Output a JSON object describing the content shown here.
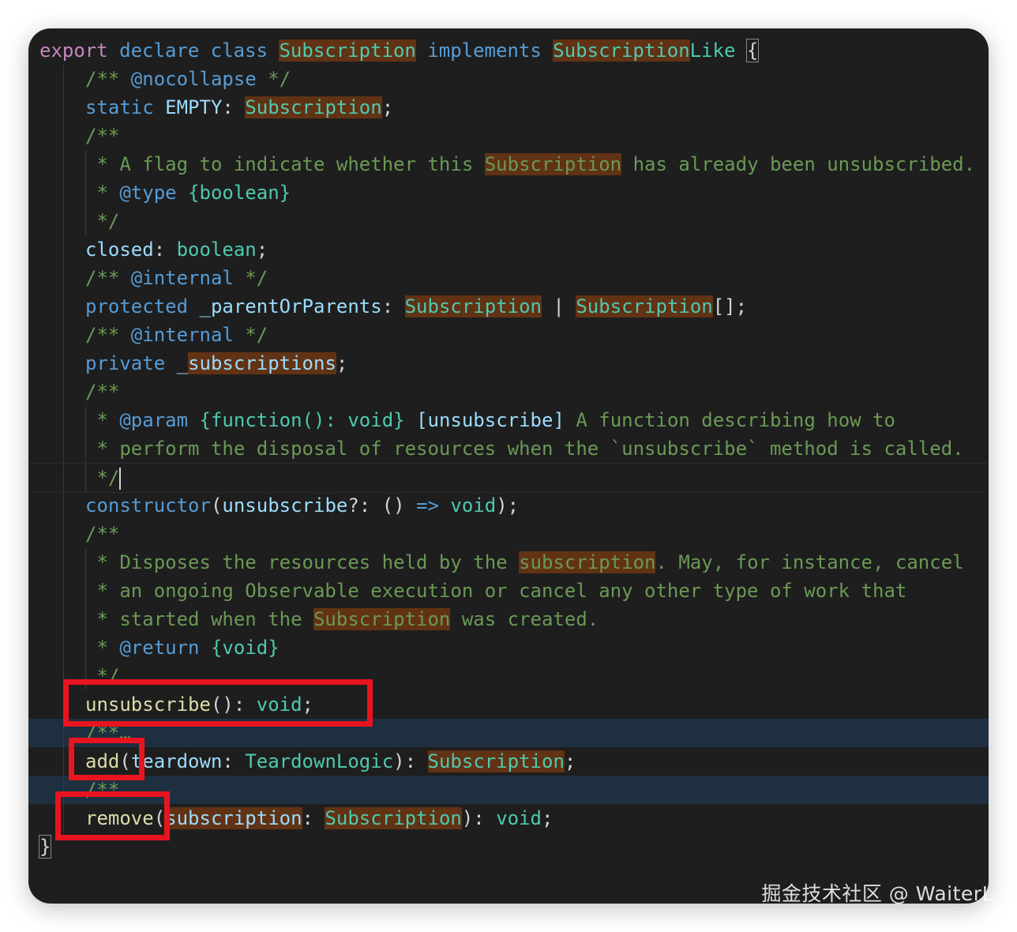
{
  "editor": {
    "lines": [
      {
        "id": "l1",
        "tokens": [
          [
            "export",
            "kw"
          ],
          [
            " ",
            "pn"
          ],
          [
            "declare",
            "kb"
          ],
          [
            " ",
            "pn"
          ],
          [
            "class",
            "kb"
          ],
          [
            " ",
            "pn"
          ],
          [
            "Subscription",
            "ty mark"
          ],
          [
            " ",
            "pn"
          ],
          [
            "implements",
            "kb"
          ],
          [
            " ",
            "pn"
          ],
          [
            "Subscription",
            "ty mark"
          ],
          [
            "Like",
            "ty"
          ],
          [
            " ",
            "pn"
          ],
          [
            "{",
            "pn brace-box"
          ]
        ]
      },
      {
        "id": "l2",
        "tokens": [
          [
            "/** ",
            "cm"
          ],
          [
            "@nocollapse",
            "cm-tag"
          ],
          [
            " */",
            "cm"
          ]
        ]
      },
      {
        "id": "l3",
        "tokens": [
          [
            "static",
            "kb"
          ],
          [
            " ",
            "pn"
          ],
          [
            "EMPTY",
            "id"
          ],
          [
            ": ",
            "pn"
          ],
          [
            "Subscription",
            "ty mark"
          ],
          [
            ";",
            "pn"
          ]
        ]
      },
      {
        "id": "l4",
        "tokens": [
          [
            "/**",
            "cm"
          ]
        ]
      },
      {
        "id": "l5",
        "tokens": [
          [
            " * A flag to indicate whether this ",
            "cm"
          ],
          [
            "Subscription",
            "cm mark"
          ],
          [
            " has already been unsubscribed.",
            "cm"
          ]
        ]
      },
      {
        "id": "l6",
        "tokens": [
          [
            " * ",
            "cm"
          ],
          [
            "@type",
            "cm-tag"
          ],
          [
            " ",
            "cm"
          ],
          [
            "{boolean}",
            "cm-type"
          ]
        ]
      },
      {
        "id": "l7",
        "tokens": [
          [
            " */",
            "cm"
          ]
        ]
      },
      {
        "id": "l8",
        "tokens": [
          [
            "closed",
            "id"
          ],
          [
            ": ",
            "pn"
          ],
          [
            "boolean",
            "ty"
          ],
          [
            ";",
            "pn"
          ]
        ]
      },
      {
        "id": "l9",
        "tokens": [
          [
            "/** ",
            "cm"
          ],
          [
            "@internal",
            "cm-tag"
          ],
          [
            " */",
            "cm"
          ]
        ]
      },
      {
        "id": "l10",
        "tokens": [
          [
            "protected",
            "kb"
          ],
          [
            " ",
            "pn"
          ],
          [
            "_parentOrParents",
            "id"
          ],
          [
            ": ",
            "pn"
          ],
          [
            "Subscription",
            "ty mark"
          ],
          [
            " | ",
            "pn"
          ],
          [
            "Subscription",
            "ty mark"
          ],
          [
            "[];",
            "pn"
          ]
        ]
      },
      {
        "id": "l11",
        "tokens": [
          [
            "/** ",
            "cm"
          ],
          [
            "@internal",
            "cm-tag"
          ],
          [
            " */",
            "cm"
          ]
        ]
      },
      {
        "id": "l12",
        "tokens": [
          [
            "private",
            "kb"
          ],
          [
            " _",
            "id"
          ],
          [
            "subscriptions",
            "id mark"
          ],
          [
            ";",
            "pn"
          ]
        ]
      },
      {
        "id": "l13",
        "tokens": [
          [
            "/**",
            "cm"
          ]
        ]
      },
      {
        "id": "l14",
        "tokens": [
          [
            " * ",
            "cm"
          ],
          [
            "@param",
            "cm-tag"
          ],
          [
            " ",
            "cm"
          ],
          [
            "{function(): void}",
            "cm-type"
          ],
          [
            " ",
            "cm"
          ],
          [
            "[unsubscribe]",
            "id"
          ],
          [
            " A function describing how to",
            "cm"
          ]
        ]
      },
      {
        "id": "l15",
        "tokens": [
          [
            " * perform the disposal of resources when the `unsubscribe` method is called.",
            "cm"
          ]
        ]
      },
      {
        "id": "l16",
        "tokens": [
          [
            " */",
            "cm"
          ]
        ],
        "caret": true
      },
      {
        "id": "l17",
        "tokens": [
          [
            "constructor",
            "kb"
          ],
          [
            "(",
            "pn"
          ],
          [
            "unsubscribe",
            "id"
          ],
          [
            "?: () ",
            "pn"
          ],
          [
            "=>",
            "kb"
          ],
          [
            " ",
            "pn"
          ],
          [
            "void",
            "ty"
          ],
          [
            ");",
            "pn"
          ]
        ]
      },
      {
        "id": "l18",
        "tokens": [
          [
            "/**",
            "cm"
          ]
        ]
      },
      {
        "id": "l19",
        "tokens": [
          [
            " * Disposes the resources held by the ",
            "cm"
          ],
          [
            "subscription",
            "cm mark"
          ],
          [
            ". May, for instance, cancel",
            "cm"
          ]
        ]
      },
      {
        "id": "l20",
        "tokens": [
          [
            " * an ongoing Observable execution or cancel any other type of work that",
            "cm"
          ]
        ]
      },
      {
        "id": "l21",
        "tokens": [
          [
            " * started when the ",
            "cm"
          ],
          [
            "Subscription",
            "cm mark"
          ],
          [
            " was created.",
            "cm"
          ]
        ]
      },
      {
        "id": "l22",
        "tokens": [
          [
            " * ",
            "cm"
          ],
          [
            "@return",
            "cm-tag"
          ],
          [
            " ",
            "cm"
          ],
          [
            "{void}",
            "cm-type"
          ]
        ]
      },
      {
        "id": "l23",
        "tokens": [
          [
            " */",
            "cm"
          ]
        ]
      },
      {
        "id": "l24",
        "tokens": [
          [
            "unsubscribe",
            "fn"
          ],
          [
            "(): ",
            "pn"
          ],
          [
            "void",
            "ty"
          ],
          [
            ";",
            "pn"
          ]
        ]
      },
      {
        "id": "l25",
        "tokens": [
          [
            "/**",
            "cm"
          ],
          [
            "…",
            "fold"
          ]
        ],
        "band": true
      },
      {
        "id": "l26",
        "tokens": [
          [
            "add",
            "fn"
          ],
          [
            "(",
            "pn"
          ],
          [
            "teardown",
            "id"
          ],
          [
            ": ",
            "pn"
          ],
          [
            "TeardownLogic",
            "ty"
          ],
          [
            "): ",
            "pn"
          ],
          [
            "Subscription",
            "ty mark"
          ],
          [
            ";",
            "pn"
          ]
        ]
      },
      {
        "id": "l27",
        "tokens": [
          [
            "/**",
            "cm"
          ],
          [
            "…",
            "fold"
          ]
        ],
        "band": true
      },
      {
        "id": "l28",
        "tokens": [
          [
            "remove",
            "fn"
          ],
          [
            "(",
            "pn"
          ],
          [
            "subscription",
            "id mark"
          ],
          [
            ": ",
            "pn"
          ],
          [
            "Subscription",
            "ty mark"
          ],
          [
            "): ",
            "pn"
          ],
          [
            "void",
            "ty"
          ],
          [
            ";",
            "pn"
          ]
        ]
      },
      {
        "id": "l29",
        "tokens": [
          [
            "}",
            "pn brace-box"
          ]
        ]
      }
    ]
  },
  "watermark": "掘金技术社区 @ WaiterL"
}
